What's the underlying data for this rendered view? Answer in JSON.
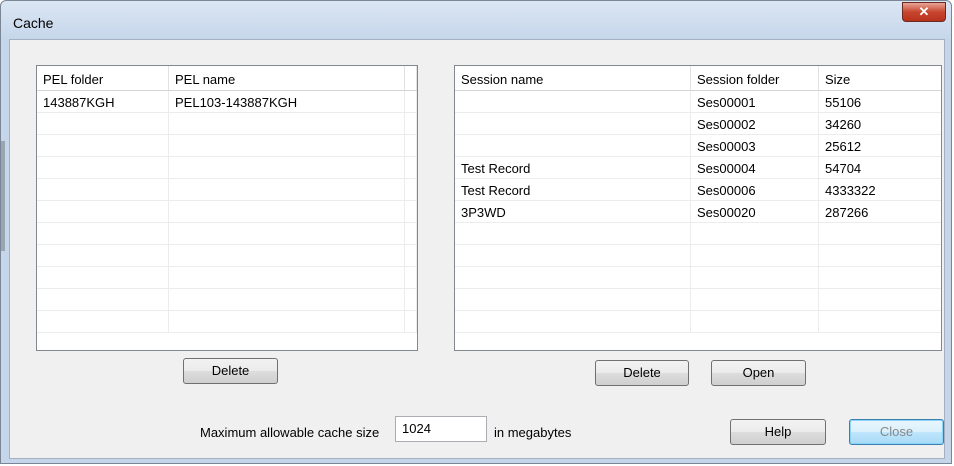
{
  "window": {
    "title": "Cache",
    "close_glyph": "✕"
  },
  "pel_table": {
    "columns": [
      "PEL folder",
      "PEL name"
    ],
    "rows": [
      [
        "143887KGH",
        "PEL103-143887KGH"
      ],
      [
        "",
        ""
      ],
      [
        "",
        ""
      ],
      [
        "",
        ""
      ],
      [
        "",
        ""
      ],
      [
        "",
        ""
      ],
      [
        "",
        ""
      ],
      [
        "",
        ""
      ],
      [
        "",
        ""
      ],
      [
        "",
        ""
      ],
      [
        "",
        ""
      ]
    ],
    "delete_label": "Delete"
  },
  "session_table": {
    "columns": [
      "Session name",
      "Session folder",
      "Size"
    ],
    "rows": [
      [
        "",
        "Ses00001",
        "55106"
      ],
      [
        "",
        "Ses00002",
        "34260"
      ],
      [
        "",
        "Ses00003",
        "25612"
      ],
      [
        "Test Record",
        "Ses00004",
        "54704"
      ],
      [
        "Test Record",
        "Ses00006",
        "4333322"
      ],
      [
        "3P3WD",
        "Ses00020",
        "287266"
      ],
      [
        "",
        "",
        ""
      ],
      [
        "",
        "",
        ""
      ],
      [
        "",
        "",
        ""
      ],
      [
        "",
        "",
        ""
      ],
      [
        "",
        "",
        ""
      ]
    ],
    "delete_label": "Delete",
    "open_label": "Open"
  },
  "cache": {
    "label": "Maximum allowable cache size",
    "value": "1024",
    "unit": "in megabytes"
  },
  "buttons": {
    "help": "Help",
    "close": "Close"
  }
}
